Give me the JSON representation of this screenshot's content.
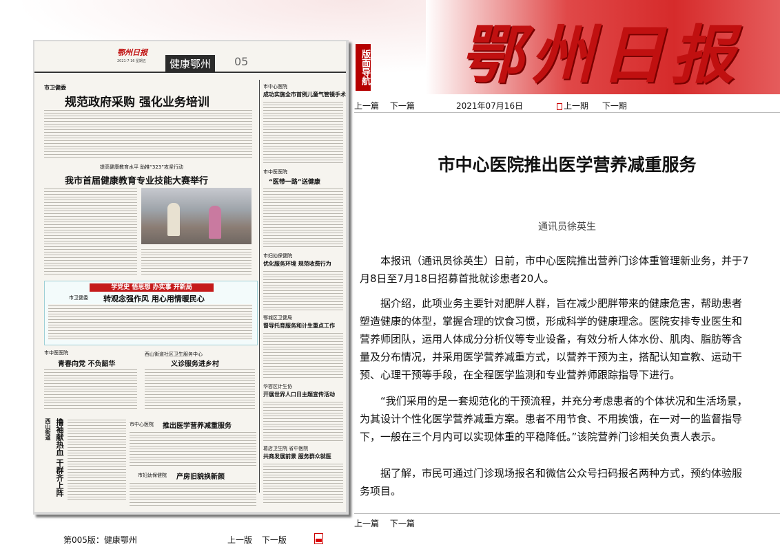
{
  "masthead": "鄂州日报",
  "nav_tag": "版面导航",
  "paper": {
    "logo": "鄂州日报",
    "date_line": "2021·7·16  星期五",
    "section": "健康鄂州",
    "page_no": "05",
    "headlines": [
      {
        "kicker": "市卫健委",
        "text": "规范政府采购  强化业务培训"
      },
      {
        "kicker": "提高健康教育水平  助推“323”攻坚行动",
        "text": "我市首届健康教育专业技能大赛举行"
      },
      {
        "kicker": "市中心医院",
        "text": "成功实施全市首例儿童气管镜手术"
      },
      {
        "kicker": "市中医医院",
        "text": "“医带一路”送健康"
      },
      {
        "kicker": "市妇幼保健院",
        "text": "优化服务环境  规范收费行为"
      },
      {
        "kicker": "鄂城区卫健局",
        "text": "督导托育服务和计生重点工作"
      },
      {
        "kicker": "华容区计生协",
        "text": "开展世界人口日主题宣传活动"
      },
      {
        "kicker": "葛店卫生院  省中医院",
        "text": "共商发展前景  服务群众就医"
      },
      {
        "kicker": "市卫健委",
        "text": "转观念强作风  用心用情暖民心"
      },
      {
        "kicker": "市中医医院",
        "text": "青春向党  不负韶华"
      },
      {
        "kicker": "西山街道社区卫生服务中心",
        "text": "义诊服务进乡村"
      },
      {
        "kicker": "市中心医院",
        "text": "推出医学营养减重服务"
      },
      {
        "kicker": "市妇幼保健院",
        "text": "产房旧貌换新颜"
      },
      {
        "kicker": "西山街道",
        "text": "撸袖献热血  干群齐上阵"
      }
    ],
    "study_banner": "学党史 悟思想 办实事 开新局"
  },
  "nav": {
    "prev_article": "上一篇",
    "next_article": "下一篇",
    "date": "2021年07月16日",
    "prev_issue": "上一期",
    "next_issue": "下一期"
  },
  "article": {
    "title": "市中心医院推出医学营养减重服务",
    "author": "通讯员徐英生",
    "paragraphs": [
      "本报讯（通讯员徐英生）日前，市中心医院推出营养门诊体重管理新业务，并于7月8日至7月18日招募首批就诊患者20人。",
      "据介绍，此项业务主要针对肥胖人群，旨在减少肥胖带来的健康危害，帮助患者塑造健康的体型，掌握合理的饮食习惯，形成科学的健康理念。医院安排专业医生和营养师团队，运用人体成分分析仪等专业设备，有效分析人体水份、肌肉、脂肪等含量及分布情况，并采用医学营养减重方式，以营养干预为主，搭配认知宣教、运动干预、心理干预等手段，在全程医学监测和专业营养师跟踪指导下进行。",
      "“我们采用的是一套规范化的干预流程，并充分考虑患者的个体状况和生活场景，为其设计个性化医学营养减重方案。患者不用节食、不用挨饿，在一对一的监督指导下，一般在三个月内可以实现体重的平稳降低。”该院营养门诊相关负责人表示。",
      "据了解，市民可通过门诊现场报名和微信公众号扫码报名两种方式，预约体验服务项目。"
    ]
  },
  "bottom_nav": {
    "prev_article": "上一篇",
    "next_article": "下一篇"
  },
  "footer": {
    "page_label": "第005版：健康鄂州",
    "prev_page": "上一版",
    "next_page": "下一版"
  }
}
